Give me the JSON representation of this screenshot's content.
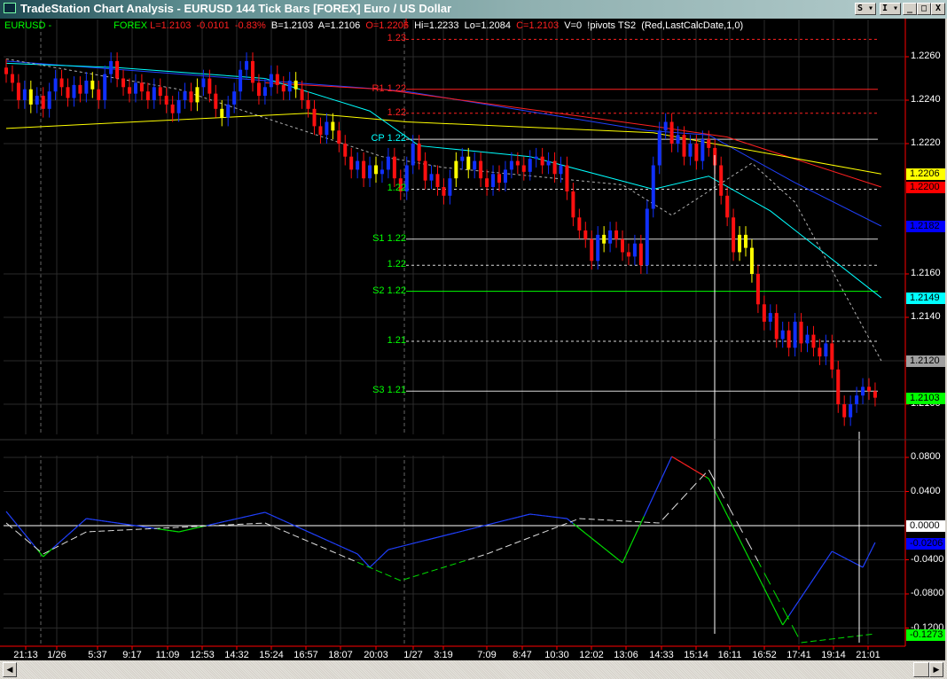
{
  "window": {
    "title": "TradeStation Chart Analysis - EURUSD  144 Tick Bars [FOREX] Euro / US Dollar",
    "buttons": {
      "s": "S ▾",
      "i": "I ▾",
      "minimize": "_",
      "maximize": "□",
      "close": "X"
    }
  },
  "header": {
    "symbol": "EURUSD -",
    "exchange": "FOREX",
    "last": "L=1.2103",
    "change": "-0.0101",
    "change_pct": "-0.83%",
    "bid": "B=1.2103",
    "ask": "A=1.2106",
    "open": "O=1.2206",
    "high": "Hi=1.2233",
    "low": "Lo=1.2084",
    "close": "C=1.2103",
    "volume": "V=0",
    "study": "!pivots TS2  (Red,LastCalcDate,1,0)"
  },
  "pivots": [
    {
      "label": "1.23",
      "price": 1.2268,
      "color": "#ff2020",
      "style": "dashed"
    },
    {
      "label": "R1 1.22",
      "price": 1.2245,
      "color": "#ff2020",
      "style": "solid"
    },
    {
      "label": "1.22",
      "price": 1.2234,
      "color": "#ff2020",
      "style": "dashed"
    },
    {
      "label": "CP 1.22",
      "price": 1.2222,
      "color": "#00ffff",
      "style": "solid"
    },
    {
      "label": "1.22",
      "price": 1.2199,
      "color": "#00ff00",
      "style": "dashed"
    },
    {
      "label": "S1 1.22",
      "price": 1.2176,
      "color": "#00ff00",
      "style": "solid"
    },
    {
      "label": "1.22",
      "price": 1.2164,
      "color": "#00ff00",
      "style": "dashed"
    },
    {
      "label": "S2 1.22",
      "price": 1.2152,
      "color": "#00ff00",
      "style": "solid"
    },
    {
      "label": "1.21",
      "price": 1.2129,
      "color": "#00ff00",
      "style": "dashed"
    },
    {
      "label": "S3 1.21",
      "price": 1.2106,
      "color": "#00ff00",
      "style": "solid"
    }
  ],
  "price_axis": {
    "ticks": [
      "1.2260",
      "1.2240",
      "1.2220",
      "1.2160",
      "1.2140",
      "1.2120",
      "1.2100"
    ],
    "tick_values": [
      1.226,
      1.224,
      1.222,
      1.216,
      1.214,
      1.212,
      1.21
    ],
    "tags": [
      {
        "text": "1.2206",
        "value": 1.2206,
        "bg": "#ffff00"
      },
      {
        "text": "1.2200",
        "value": 1.22,
        "bg": "#ff0000"
      },
      {
        "text": "1.2182",
        "value": 1.2182,
        "bg": "#0000ff"
      },
      {
        "text": "1.2149",
        "value": 1.2149,
        "bg": "#00ffff"
      },
      {
        "text": "1.2120",
        "value": 1.212,
        "bg": "#a0a0a0"
      },
      {
        "text": "1.2103",
        "value": 1.2103,
        "bg": "#00ff00"
      }
    ]
  },
  "indicator_axis": {
    "ticks": [
      "0.0800",
      "0.0400",
      "-0.0400",
      "-0.0800",
      "-0.1200"
    ],
    "tick_values": [
      0.08,
      0.04,
      -0.04,
      -0.08,
      -0.12
    ],
    "tags": [
      {
        "text": "0.0000",
        "value": 0.0,
        "bg": "#ffffff"
      },
      {
        "text": "-0.0206",
        "value": -0.0206,
        "bg": "#0000ff"
      },
      {
        "text": "-0.1273",
        "value": -0.1273,
        "bg": "#00ff00"
      }
    ]
  },
  "time_axis": [
    "21:13",
    "1/26",
    "5:37",
    "9:17",
    "11:09",
    "12:53",
    "14:32",
    "15:24",
    "16:57",
    "18:07",
    "20:03",
    "1/27",
    "3:19",
    "7:09",
    "8:47",
    "10:30",
    "12:02",
    "13:06",
    "14:33",
    "15:14",
    "16:11",
    "16:52",
    "17:41",
    "19:14",
    "21:01"
  ],
  "chart_data": {
    "type": "candlestick",
    "title": "EURUSD 144 Tick Bars",
    "ylim": [
      1.2084,
      1.2275
    ],
    "closes": [
      1.2252,
      1.2248,
      1.224,
      1.2245,
      1.2238,
      1.2242,
      1.2236,
      1.2244,
      1.225,
      1.2246,
      1.2241,
      1.2247,
      1.2243,
      1.2249,
      1.2245,
      1.224,
      1.2252,
      1.2258,
      1.225,
      1.2246,
      1.2243,
      1.2248,
      1.2244,
      1.224,
      1.2246,
      1.2242,
      1.2238,
      1.2234,
      1.224,
      1.2244,
      1.2239,
      1.2246,
      1.225,
      1.2243,
      1.2236,
      1.2232,
      1.2238,
      1.2244,
      1.2254,
      1.2258,
      1.2248,
      1.2242,
      1.2246,
      1.2252,
      1.2247,
      1.2244,
      1.2249,
      1.2245,
      1.224,
      1.2236,
      1.2228,
      1.2224,
      1.223,
      1.2226,
      1.222,
      1.2214,
      1.2208,
      1.2212,
      1.2204,
      1.221,
      1.2206,
      1.2208,
      1.2214,
      1.2204,
      1.2198,
      1.221,
      1.222,
      1.2212,
      1.2203,
      1.2206,
      1.22,
      1.2196,
      1.2204,
      1.2212,
      1.2214,
      1.2208,
      1.2212,
      1.2204,
      1.22,
      1.2206,
      1.2202,
      1.2208,
      1.2212,
      1.221,
      1.2207,
      1.2213,
      1.2214,
      1.221,
      1.2212,
      1.2206,
      1.221,
      1.2198,
      1.2186,
      1.218,
      1.2176,
      1.2166,
      1.2178,
      1.2174,
      1.218,
      1.2176,
      1.217,
      1.2168,
      1.2174,
      1.2164,
      1.219,
      1.221,
      1.2226,
      1.223,
      1.222,
      1.2224,
      1.2214,
      1.222,
      1.2212,
      1.2222,
      1.2218,
      1.221,
      1.2196,
      1.2186,
      1.217,
      1.2178,
      1.2172,
      1.216,
      1.2146,
      1.2138,
      1.2142,
      1.213,
      1.2134,
      1.2126,
      1.2138,
      1.2128,
      1.2132,
      1.2126,
      1.2122,
      1.2128,
      1.2116,
      1.21,
      1.2094,
      1.21,
      1.2104,
      1.2108,
      1.2106,
      1.2103
    ],
    "yellow_bars": [
      4,
      14,
      31,
      35,
      47,
      53,
      60,
      73,
      75,
      97,
      119,
      120,
      121
    ],
    "moving_averages": [
      {
        "name": "blue-ma",
        "color": "#2040ff",
        "points": [
          [
            0,
            1.2258
          ],
          [
            61,
            1.2245
          ],
          [
            65,
            1.2244
          ],
          [
            104,
            1.2226
          ],
          [
            114,
            1.2224
          ],
          [
            128,
            1.2202
          ],
          [
            142,
            1.2182
          ]
        ]
      },
      {
        "name": "red-ma",
        "color": "#ff2020",
        "points": [
          [
            42,
            1.2248
          ],
          [
            61,
            1.2245
          ],
          [
            105,
            1.2228
          ],
          [
            117,
            1.2223
          ],
          [
            142,
            1.22
          ]
        ]
      },
      {
        "name": "yellow-ma",
        "color": "#ffff00",
        "points": [
          [
            0,
            1.2227
          ],
          [
            49,
            1.2234
          ],
          [
            65,
            1.223
          ],
          [
            105,
            1.2225
          ],
          [
            142,
            1.2206
          ]
        ]
      },
      {
        "name": "cyan-ma",
        "color": "#00ffff",
        "points": [
          [
            0,
            1.2257
          ],
          [
            18,
            1.2255
          ],
          [
            42,
            1.225
          ],
          [
            59,
            1.2235
          ],
          [
            67,
            1.2219
          ],
          [
            85,
            1.2214
          ],
          [
            105,
            1.2199
          ],
          [
            114,
            1.2205
          ],
          [
            124,
            1.2189
          ],
          [
            142,
            1.2149
          ]
        ]
      },
      {
        "name": "grey-dashed-ma",
        "color": "#b0b0b0",
        "dashed": true,
        "points": [
          [
            0,
            1.2259
          ],
          [
            28,
            1.2245
          ],
          [
            61,
            1.2214
          ],
          [
            71,
            1.2209
          ],
          [
            100,
            1.2201
          ],
          [
            108,
            1.2187
          ],
          [
            121,
            1.2211
          ],
          [
            128,
            1.2193
          ],
          [
            142,
            1.212
          ]
        ]
      }
    ],
    "oscillator": {
      "ylim": [
        -0.14,
        0.09
      ],
      "main": [
        [
          0,
          0.0166
        ],
        [
          6,
          -0.0364
        ],
        [
          13,
          0.0083
        ],
        [
          28,
          -0.0073
        ],
        [
          42,
          0.0156
        ],
        [
          57,
          -0.0332
        ],
        [
          59,
          -0.0488
        ],
        [
          62,
          -0.0281
        ],
        [
          85,
          0.0135
        ],
        [
          91,
          0.0083
        ],
        [
          100,
          -0.0436
        ],
        [
          108,
          0.081
        ],
        [
          114,
          0.0551
        ],
        [
          126,
          -0.1164
        ],
        [
          134,
          -0.0301
        ],
        [
          139,
          -0.0488
        ],
        [
          141,
          -0.0197
        ]
      ],
      "signal": [
        [
          0,
          0.0031
        ],
        [
          6,
          -0.0332
        ],
        [
          13,
          -0.0073
        ],
        [
          42,
          0.0031
        ],
        [
          64,
          -0.0644
        ],
        [
          78,
          -0.0332
        ],
        [
          93,
          0.0083
        ],
        [
          106,
          0.0031
        ],
        [
          114,
          0.0655
        ],
        [
          121,
          -0.0281
        ],
        [
          129,
          -0.1371
        ],
        [
          141,
          -0.1268
        ]
      ]
    }
  }
}
